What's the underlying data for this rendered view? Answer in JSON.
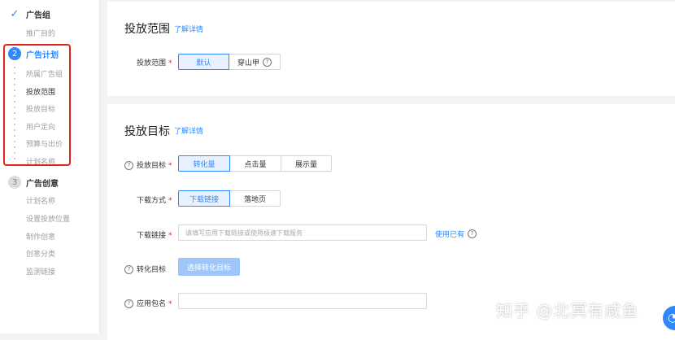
{
  "sidebar": {
    "step1": {
      "label": "广告组",
      "items": [
        "推广目的"
      ]
    },
    "step2": {
      "number": "2",
      "label": "广告计划",
      "items": [
        "所属广告组",
        "投放范围",
        "投放目标",
        "用户定向",
        "预算与出价",
        "计划名称"
      ]
    },
    "step3": {
      "number": "3",
      "label": "广告创意",
      "items": [
        "计划名称",
        "设置投放位置",
        "制作创意",
        "创意分类",
        "监测链接"
      ]
    }
  },
  "section1": {
    "title": "投放范围",
    "detail_link": "了解详情",
    "field_label": "投放范围",
    "options": [
      "默认",
      "穿山甲"
    ]
  },
  "section2": {
    "title": "投放目标",
    "detail_link": "了解详情",
    "goal": {
      "label": "投放目标",
      "options": [
        "转化量",
        "点击量",
        "展示量"
      ]
    },
    "download_method": {
      "label": "下载方式",
      "options": [
        "下载链接",
        "落地页"
      ]
    },
    "download_link": {
      "label": "下载链接",
      "placeholder": "请填写应用下载链接或使用极速下载服务",
      "use_existing": "使用已有"
    },
    "conversion_goal": {
      "label": "转化目标",
      "button": "选择转化目标"
    },
    "package_name": {
      "label": "应用包名"
    }
  },
  "required_mark": "*",
  "help_glyph": "?",
  "watermark": "知乎 @北冥有咸鱼",
  "colors": {
    "accent": "#2f88ff",
    "highlight": "#e0231e"
  }
}
